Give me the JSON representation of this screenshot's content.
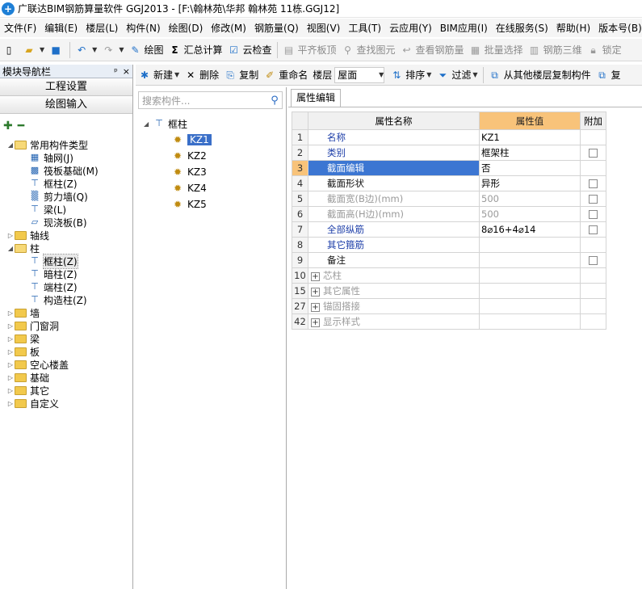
{
  "window": {
    "title": "广联达BIM钢筋算量软件 GGJ2013 - [F:\\翰林苑\\华邦 翰林苑 11栋.GGJ12]"
  },
  "menu": [
    "文件(F)",
    "编辑(E)",
    "楼层(L)",
    "构件(N)",
    "绘图(D)",
    "修改(M)",
    "钢筋量(Q)",
    "视图(V)",
    "工具(T)",
    "云应用(Y)",
    "BIM应用(I)",
    "在线服务(S)",
    "帮助(H)",
    "版本号(B)"
  ],
  "toolbar": {
    "draw": "绘图",
    "sum_calc": "汇总计算",
    "cloud_check": "云检查",
    "flush_slab": "平齐板顶",
    "find_element": "查找图元",
    "view_rebar": "查看钢筋量",
    "batch_select": "批量选择",
    "rebar_3d": "钢筋三维",
    "lock": "锁定"
  },
  "nav": {
    "header": "模块导航栏",
    "pin": "ᵖ",
    "close": "×",
    "project_settings": "工程设置",
    "drawing_input": "绘图输入",
    "tree": [
      {
        "label": "常用构件类型",
        "level": 0,
        "type": "folder-open",
        "expand": "◢"
      },
      {
        "label": "轴网(J)",
        "level": 1,
        "type": "leaf",
        "icon": "grid"
      },
      {
        "label": "筏板基础(M)",
        "level": 1,
        "type": "leaf",
        "icon": "raft"
      },
      {
        "label": "框柱(Z)",
        "level": 1,
        "type": "leaf",
        "icon": "column"
      },
      {
        "label": "剪力墙(Q)",
        "level": 1,
        "type": "leaf",
        "icon": "wall"
      },
      {
        "label": "梁(L)",
        "level": 1,
        "type": "leaf",
        "icon": "beam"
      },
      {
        "label": "现浇板(B)",
        "level": 1,
        "type": "leaf",
        "icon": "slab"
      },
      {
        "label": "轴线",
        "level": 0,
        "type": "folder",
        "expand": "▷"
      },
      {
        "label": "柱",
        "level": 0,
        "type": "folder-open",
        "expand": "◢"
      },
      {
        "label": "框柱(Z)",
        "level": 1,
        "type": "leaf",
        "icon": "column",
        "selected": true
      },
      {
        "label": "暗柱(Z)",
        "level": 1,
        "type": "leaf",
        "icon": "column"
      },
      {
        "label": "端柱(Z)",
        "level": 1,
        "type": "leaf",
        "icon": "column"
      },
      {
        "label": "构造柱(Z)",
        "level": 1,
        "type": "leaf",
        "icon": "column"
      },
      {
        "label": "墙",
        "level": 0,
        "type": "folder",
        "expand": "▷"
      },
      {
        "label": "门窗洞",
        "level": 0,
        "type": "folder",
        "expand": "▷"
      },
      {
        "label": "梁",
        "level": 0,
        "type": "folder",
        "expand": "▷"
      },
      {
        "label": "板",
        "level": 0,
        "type": "folder",
        "expand": "▷"
      },
      {
        "label": "空心楼盖",
        "level": 0,
        "type": "folder",
        "expand": "▷"
      },
      {
        "label": "基础",
        "level": 0,
        "type": "folder",
        "expand": "▷"
      },
      {
        "label": "其它",
        "level": 0,
        "type": "folder",
        "expand": "▷"
      },
      {
        "label": "自定义",
        "level": 0,
        "type": "folder",
        "expand": "▷"
      }
    ]
  },
  "mid_toolbar": {
    "new": "新建",
    "delete": "删除",
    "copy": "复制",
    "rename": "重命名",
    "floor_label": "楼层",
    "floor_value": "屋面",
    "sort": "排序",
    "filter": "过滤",
    "copy_from_floor": "从其他楼层复制构件",
    "copy2": "复"
  },
  "components": {
    "search_placeholder": "搜索构件...",
    "root": "框柱",
    "items": [
      {
        "label": "KZ1",
        "selected": true
      },
      {
        "label": "KZ2"
      },
      {
        "label": "KZ3"
      },
      {
        "label": "KZ4"
      },
      {
        "label": "KZ5"
      }
    ]
  },
  "properties": {
    "tab": "属性编辑",
    "headers": {
      "name": "属性名称",
      "value": "属性值",
      "extra": "附加"
    },
    "rows": [
      {
        "num": "1",
        "name": "名称",
        "value": "KZ1",
        "style": "blue",
        "check": false
      },
      {
        "num": "2",
        "name": "类别",
        "value": "框架柱",
        "style": "blue",
        "check": true
      },
      {
        "num": "3",
        "name": "截面编辑",
        "value": "否",
        "style": "blue",
        "check": false,
        "active": true
      },
      {
        "num": "4",
        "name": "截面形状",
        "value": "异形",
        "style": "black",
        "check": true
      },
      {
        "num": "5",
        "name": "截面宽(B边)(mm)",
        "value": "500",
        "style": "gray",
        "check": true
      },
      {
        "num": "6",
        "name": "截面高(H边)(mm)",
        "value": "500",
        "style": "gray",
        "check": true
      },
      {
        "num": "7",
        "name": "全部纵筋",
        "value": "8⌀16+4⌀14",
        "style": "blue",
        "check": true
      },
      {
        "num": "8",
        "name": "其它箍筋",
        "value": "",
        "style": "blue",
        "check": false
      },
      {
        "num": "9",
        "name": "备注",
        "value": "",
        "style": "black",
        "check": true
      },
      {
        "num": "10",
        "name": "芯柱",
        "value": "",
        "style": "gray",
        "group": true
      },
      {
        "num": "15",
        "name": "其它属性",
        "value": "",
        "style": "gray",
        "group": true
      },
      {
        "num": "27",
        "name": "锚固搭接",
        "value": "",
        "style": "gray",
        "group": true
      },
      {
        "num": "42",
        "name": "显示样式",
        "value": "",
        "style": "gray",
        "group": true
      }
    ]
  }
}
